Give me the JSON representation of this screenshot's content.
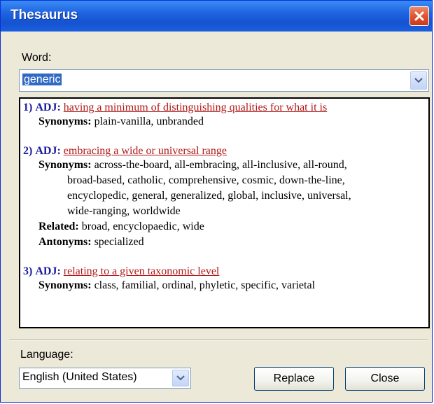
{
  "window": {
    "title": "Thesaurus"
  },
  "word": {
    "label": "Word:",
    "value": "generic"
  },
  "senses": [
    {
      "num": "1)",
      "pos": "ADJ:",
      "gloss": "having a minimum of distinguishing qualities for what it is",
      "synonyms_label": "Synonyms:",
      "synonyms": "plain-vanilla, unbranded"
    },
    {
      "num": "2)",
      "pos": "ADJ:",
      "gloss": "embracing a wide or universal range",
      "synonyms_label": "Synonyms:",
      "synonyms_lines": [
        "across-the-board, all-embracing, all-inclusive, all-round,",
        "broad-based, catholic, comprehensive, cosmic, down-the-line,",
        "encyclopedic, general, generalized, global, inclusive, universal,",
        "wide-ranging, worldwide"
      ],
      "related_label": "Related:",
      "related": "broad, encyclopaedic, wide",
      "antonyms_label": "Antonyms:",
      "antonyms": "specialized"
    },
    {
      "num": "3)",
      "pos": "ADJ:",
      "gloss": "relating to a given taxonomic level",
      "synonyms_label": "Synonyms:",
      "synonyms": "class, familial, ordinal, phyletic, specific, varietal"
    }
  ],
  "language": {
    "label": "Language:",
    "value": "English (United States)"
  },
  "buttons": {
    "replace": "Replace",
    "close": "Close"
  },
  "colors": {
    "titlebar": "#1f63e0",
    "sense_number": "#1c1c9c",
    "gloss_link": "#b01818",
    "selection": "#316ac5"
  }
}
